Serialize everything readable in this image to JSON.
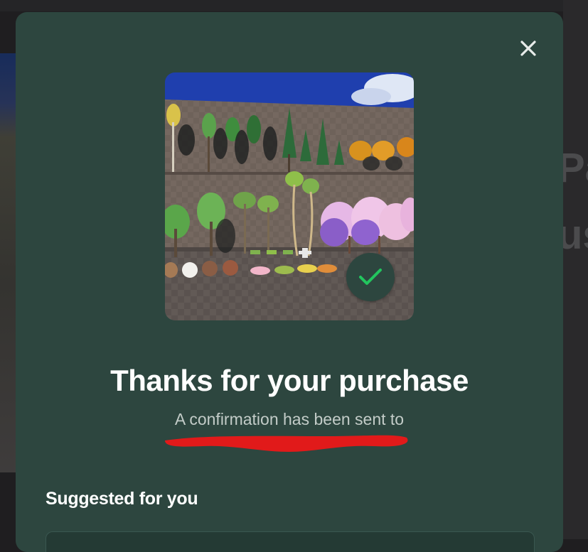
{
  "modal": {
    "close_icon": "close-icon",
    "product_image_alt": "",
    "success_icon": "checkmark-icon",
    "success_color": "#22c55e",
    "title": "Thanks for your purchase",
    "subtitle": "A confirmation has been sent to",
    "suggested_heading": "Suggested for you"
  },
  "background_page": {
    "partial_text_1": "Pa",
    "partial_text_2": "us"
  },
  "colors": {
    "modal_bg": "#2d463f",
    "backdrop": "#1f1e20",
    "redaction": "#e11a1a"
  }
}
